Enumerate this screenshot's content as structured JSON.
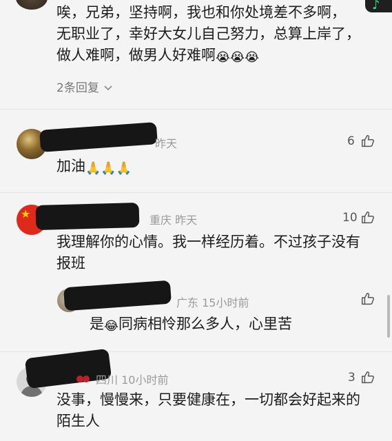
{
  "colors": {
    "background": "#f4f4f4",
    "meta": "#9a9a9a",
    "text": "#1c1c1c",
    "redaction": "#161616"
  },
  "top_comment": {
    "lines": [
      "唉，兄弟，坚持啊，我也和你处境差不多啊，",
      "无职业了，幸好大女儿自己努力，总算上岸了，",
      "做人难啊，做男人好难啊"
    ],
    "emoji": "😭😭😭",
    "replies_label": "2条回复",
    "replies_chevron": "chevron-down-icon"
  },
  "comments": [
    {
      "meta": "昨天",
      "like_count": "6",
      "text": "加油",
      "emoji": "🙏🙏🙏"
    },
    {
      "meta": "重庆 昨天",
      "like_count": "10",
      "lines": [
        "我理解你的心情。我一样经历着。不过孩子没有",
        "报班"
      ],
      "reply": {
        "meta": "广东 15小时前",
        "text_prefix": "是",
        "emoji": "😂",
        "text": "同病相怜那么多人，心里苦"
      }
    },
    {
      "meta": "四川 10小时前",
      "like_count": "3",
      "lines": [
        "没事，慢慢来，只要健康在，一切都会好起来的",
        "陌生人"
      ]
    }
  ],
  "icons": {
    "like": "thumbs-up-icon",
    "music": "music-note-icon"
  }
}
